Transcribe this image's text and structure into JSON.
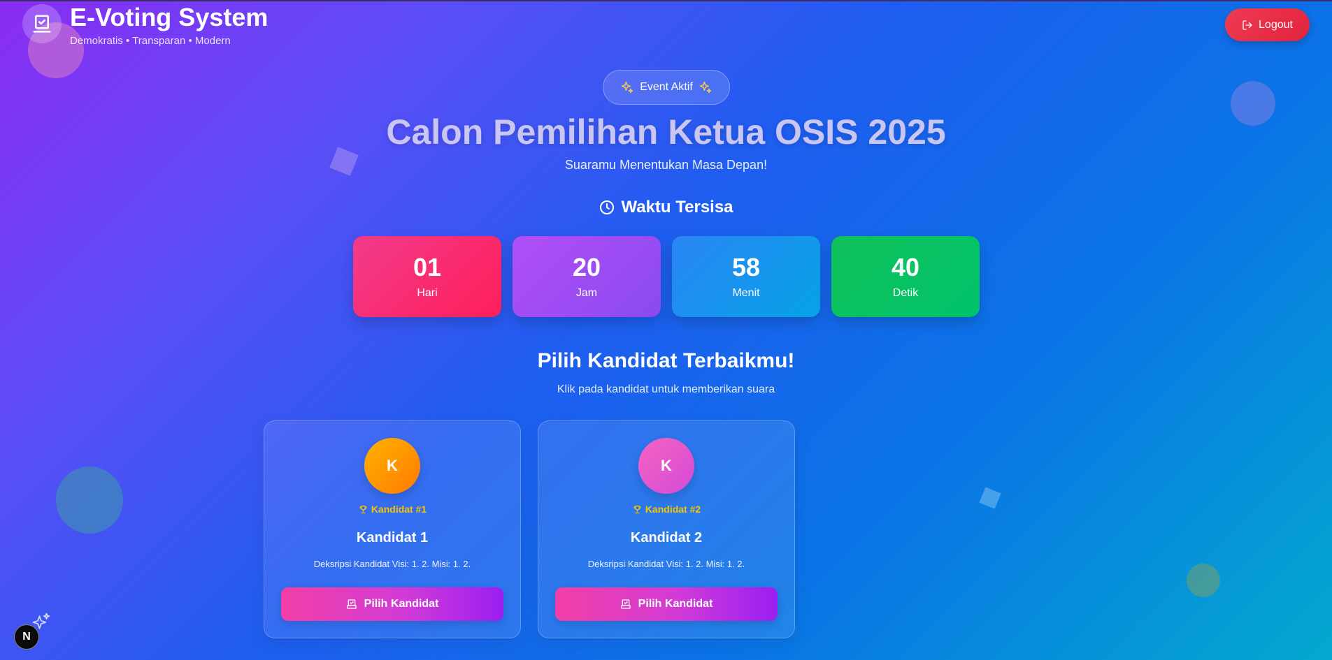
{
  "header": {
    "title": "E-Voting System",
    "subtitle": "Demokratis • Transparan • Modern",
    "logout_label": "Logout"
  },
  "hero": {
    "badge_label": "Event Aktif",
    "title": "Calon Pemilihan Ketua OSIS 2025",
    "subtitle": "Suaramu Menentukan Masa Depan!"
  },
  "timer": {
    "title": "Waktu Tersisa",
    "units": [
      {
        "value": "01",
        "label": "Hari"
      },
      {
        "value": "20",
        "label": "Jam"
      },
      {
        "value": "58",
        "label": "Menit"
      },
      {
        "value": "40",
        "label": "Detik"
      }
    ]
  },
  "candidates_section": {
    "title": "Pilih Kandidat Terbaikmu!",
    "subtitle": "Klik pada kandidat untuk memberikan suara"
  },
  "candidates": [
    {
      "initial": "K",
      "number_label": "Kandidat #1",
      "name": "Kandidat 1",
      "description": "Deksripsi Kandidat Visi: 1. 2. Misi: 1. 2.",
      "button_label": "Pilih Kandidat"
    },
    {
      "initial": "K",
      "number_label": "Kandidat #2",
      "name": "Kandidat 2",
      "description": "Deksripsi Kandidat Visi: 1. 2. Misi: 1. 2.",
      "button_label": "Pilih Kandidat"
    }
  ],
  "dev_indicator": {
    "letter": "N"
  },
  "colors": {
    "logout": "#e2233c",
    "timer_days": "#f23b8b",
    "timer_hours": "#a54df5",
    "timer_minutes": "#1a93ee",
    "timer_seconds": "#08c263",
    "candidate_number": "#f5c400"
  }
}
